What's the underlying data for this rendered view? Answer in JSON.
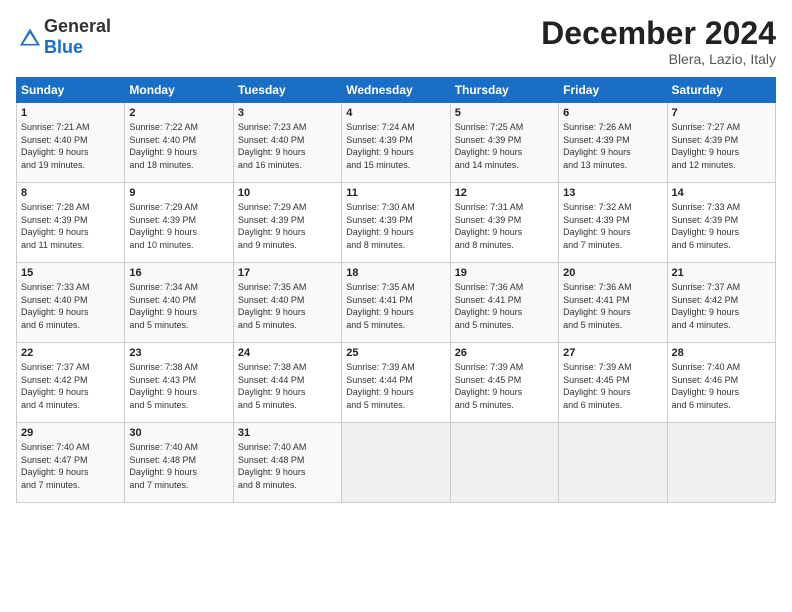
{
  "logo": {
    "general": "General",
    "blue": "Blue"
  },
  "header": {
    "month": "December 2024",
    "location": "Blera, Lazio, Italy"
  },
  "weekdays": [
    "Sunday",
    "Monday",
    "Tuesday",
    "Wednesday",
    "Thursday",
    "Friday",
    "Saturday"
  ],
  "weeks": [
    [
      {
        "day": "1",
        "detail": "Sunrise: 7:21 AM\nSunset: 4:40 PM\nDaylight: 9 hours\nand 19 minutes."
      },
      {
        "day": "2",
        "detail": "Sunrise: 7:22 AM\nSunset: 4:40 PM\nDaylight: 9 hours\nand 18 minutes."
      },
      {
        "day": "3",
        "detail": "Sunrise: 7:23 AM\nSunset: 4:40 PM\nDaylight: 9 hours\nand 16 minutes."
      },
      {
        "day": "4",
        "detail": "Sunrise: 7:24 AM\nSunset: 4:39 PM\nDaylight: 9 hours\nand 15 minutes."
      },
      {
        "day": "5",
        "detail": "Sunrise: 7:25 AM\nSunset: 4:39 PM\nDaylight: 9 hours\nand 14 minutes."
      },
      {
        "day": "6",
        "detail": "Sunrise: 7:26 AM\nSunset: 4:39 PM\nDaylight: 9 hours\nand 13 minutes."
      },
      {
        "day": "7",
        "detail": "Sunrise: 7:27 AM\nSunset: 4:39 PM\nDaylight: 9 hours\nand 12 minutes."
      }
    ],
    [
      {
        "day": "8",
        "detail": "Sunrise: 7:28 AM\nSunset: 4:39 PM\nDaylight: 9 hours\nand 11 minutes."
      },
      {
        "day": "9",
        "detail": "Sunrise: 7:29 AM\nSunset: 4:39 PM\nDaylight: 9 hours\nand 10 minutes."
      },
      {
        "day": "10",
        "detail": "Sunrise: 7:29 AM\nSunset: 4:39 PM\nDaylight: 9 hours\nand 9 minutes."
      },
      {
        "day": "11",
        "detail": "Sunrise: 7:30 AM\nSunset: 4:39 PM\nDaylight: 9 hours\nand 8 minutes."
      },
      {
        "day": "12",
        "detail": "Sunrise: 7:31 AM\nSunset: 4:39 PM\nDaylight: 9 hours\nand 8 minutes."
      },
      {
        "day": "13",
        "detail": "Sunrise: 7:32 AM\nSunset: 4:39 PM\nDaylight: 9 hours\nand 7 minutes."
      },
      {
        "day": "14",
        "detail": "Sunrise: 7:33 AM\nSunset: 4:39 PM\nDaylight: 9 hours\nand 6 minutes."
      }
    ],
    [
      {
        "day": "15",
        "detail": "Sunrise: 7:33 AM\nSunset: 4:40 PM\nDaylight: 9 hours\nand 6 minutes."
      },
      {
        "day": "16",
        "detail": "Sunrise: 7:34 AM\nSunset: 4:40 PM\nDaylight: 9 hours\nand 5 minutes."
      },
      {
        "day": "17",
        "detail": "Sunrise: 7:35 AM\nSunset: 4:40 PM\nDaylight: 9 hours\nand 5 minutes."
      },
      {
        "day": "18",
        "detail": "Sunrise: 7:35 AM\nSunset: 4:41 PM\nDaylight: 9 hours\nand 5 minutes."
      },
      {
        "day": "19",
        "detail": "Sunrise: 7:36 AM\nSunset: 4:41 PM\nDaylight: 9 hours\nand 5 minutes."
      },
      {
        "day": "20",
        "detail": "Sunrise: 7:36 AM\nSunset: 4:41 PM\nDaylight: 9 hours\nand 5 minutes."
      },
      {
        "day": "21",
        "detail": "Sunrise: 7:37 AM\nSunset: 4:42 PM\nDaylight: 9 hours\nand 4 minutes."
      }
    ],
    [
      {
        "day": "22",
        "detail": "Sunrise: 7:37 AM\nSunset: 4:42 PM\nDaylight: 9 hours\nand 4 minutes."
      },
      {
        "day": "23",
        "detail": "Sunrise: 7:38 AM\nSunset: 4:43 PM\nDaylight: 9 hours\nand 5 minutes."
      },
      {
        "day": "24",
        "detail": "Sunrise: 7:38 AM\nSunset: 4:44 PM\nDaylight: 9 hours\nand 5 minutes."
      },
      {
        "day": "25",
        "detail": "Sunrise: 7:39 AM\nSunset: 4:44 PM\nDaylight: 9 hours\nand 5 minutes."
      },
      {
        "day": "26",
        "detail": "Sunrise: 7:39 AM\nSunset: 4:45 PM\nDaylight: 9 hours\nand 5 minutes."
      },
      {
        "day": "27",
        "detail": "Sunrise: 7:39 AM\nSunset: 4:45 PM\nDaylight: 9 hours\nand 6 minutes."
      },
      {
        "day": "28",
        "detail": "Sunrise: 7:40 AM\nSunset: 4:46 PM\nDaylight: 9 hours\nand 6 minutes."
      }
    ],
    [
      {
        "day": "29",
        "detail": "Sunrise: 7:40 AM\nSunset: 4:47 PM\nDaylight: 9 hours\nand 7 minutes."
      },
      {
        "day": "30",
        "detail": "Sunrise: 7:40 AM\nSunset: 4:48 PM\nDaylight: 9 hours\nand 7 minutes."
      },
      {
        "day": "31",
        "detail": "Sunrise: 7:40 AM\nSunset: 4:48 PM\nDaylight: 9 hours\nand 8 minutes."
      },
      {
        "day": "",
        "detail": ""
      },
      {
        "day": "",
        "detail": ""
      },
      {
        "day": "",
        "detail": ""
      },
      {
        "day": "",
        "detail": ""
      }
    ]
  ]
}
